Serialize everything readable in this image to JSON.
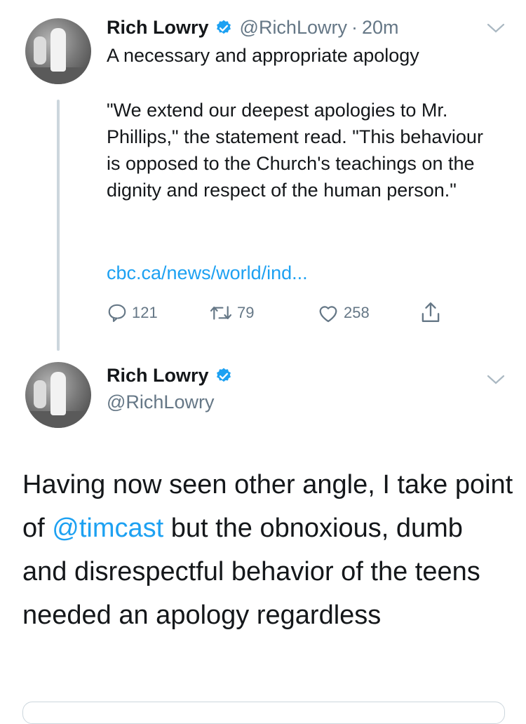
{
  "tweet1": {
    "name": "Rich Lowry",
    "handle": "@RichLowry",
    "separator": "·",
    "time": "20m",
    "line1": "A necessary and appropriate apology",
    "quote": "\"We extend our deepest apologies to Mr. Phillips,\" the statement read. \"This behaviour is opposed to the Church's teachings on the dignity and respect of the human person.\"",
    "link": "cbc.ca/news/world/ind...",
    "replies": "121",
    "retweets": "79",
    "likes": "258"
  },
  "tweet2": {
    "name": "Rich Lowry",
    "handle": "@RichLowry",
    "text_before": "Having now seen other angle, I take point of ",
    "mention": "@timcast",
    "text_after": " but the obnoxious, dumb and disrespectful behavior of the teens needed an apology regardless"
  },
  "colors": {
    "link": "#1da1f2",
    "verified": "#1da1f2",
    "muted": "#657786",
    "text": "#14171a"
  },
  "icons": [
    "verified-badge-icon",
    "chevron-down-icon",
    "reply-icon",
    "retweet-icon",
    "like-icon",
    "share-icon"
  ]
}
